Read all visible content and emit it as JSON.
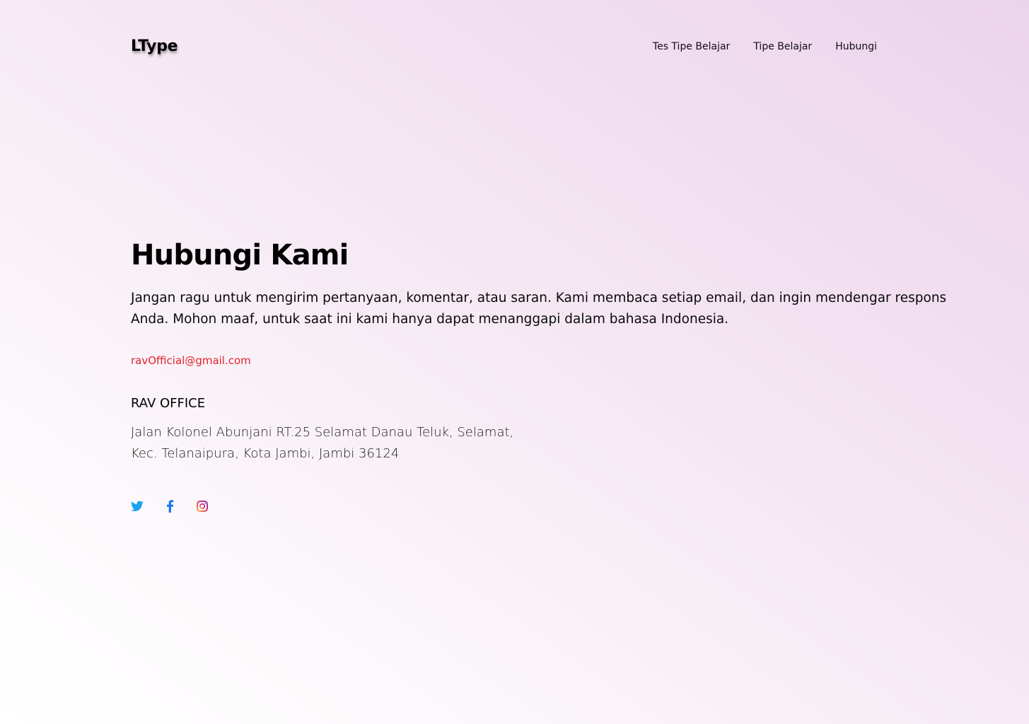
{
  "header": {
    "logo": "LType",
    "nav": [
      {
        "label": "Tes Tipe Belajar"
      },
      {
        "label": "Tipe Belajar"
      },
      {
        "label": "Hubungi"
      }
    ]
  },
  "contact": {
    "title": "Hubungi Kami",
    "description": "Jangan ragu untuk mengirim pertanyaan, komentar, atau saran. Kami membaca setiap email, dan ingin mendengar respons Anda. Mohon maaf, untuk saat ini kami hanya dapat menanggapi dalam bahasa Indonesia.",
    "email": "ravOfficial@gmail.com",
    "office_title": "RAV OFFICE",
    "address_line1": "Jalan Kolonel Abunjani RT.25 Selamat Danau Teluk, Selamat,",
    "address_line2": "Kec. Telanaipura, Kota Jambi, Jambi 36124"
  },
  "socials": [
    {
      "icon": "twitter-icon",
      "color": "#1da1f2"
    },
    {
      "icon": "facebook-icon",
      "color": "#1877f2"
    },
    {
      "icon": "instagram-icon",
      "color": "#e1306c"
    }
  ],
  "colors": {
    "email": "#e3242b",
    "background_start": "#ecd3ec",
    "background_end": "#ffffff"
  }
}
